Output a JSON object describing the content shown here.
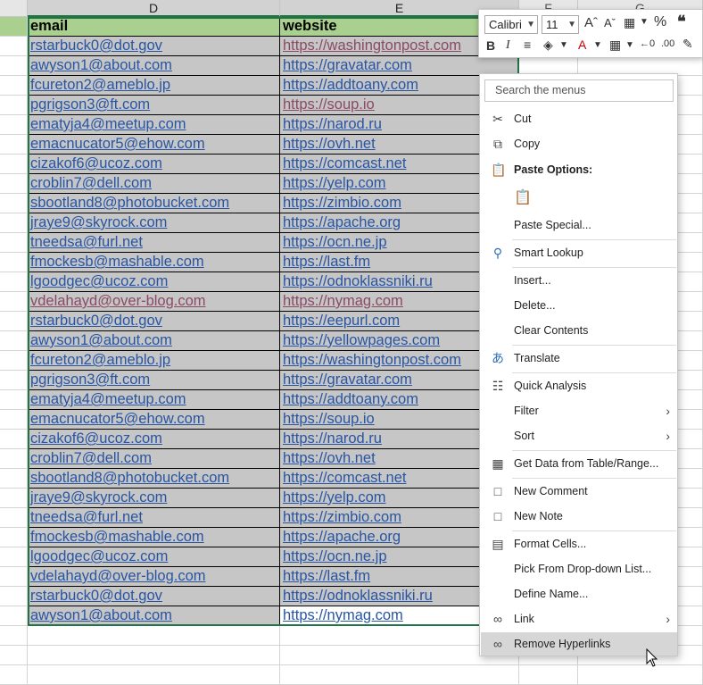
{
  "columns": {
    "d": "D",
    "e": "E",
    "f": "F",
    "g": "G"
  },
  "header": {
    "email": "email",
    "website": "website"
  },
  "rows": [
    {
      "email": "rstarbuck0@dot.gov",
      "website": "https://washingtonpost.com"
    },
    {
      "email": "awyson1@about.com",
      "website": "https://gravatar.com"
    },
    {
      "email": "fcureton2@ameblo.jp",
      "website": "https://addtoany.com"
    },
    {
      "email": "pgrigson3@ft.com",
      "website": "https://soup.io"
    },
    {
      "email": "ematyja4@meetup.com",
      "website": "https://narod.ru"
    },
    {
      "email": "emacnucator5@ehow.com",
      "website": "https://ovh.net"
    },
    {
      "email": "cizakof6@ucoz.com",
      "website": "https://comcast.net"
    },
    {
      "email": "croblin7@dell.com",
      "website": "https://yelp.com"
    },
    {
      "email": "sbootland8@photobucket.com",
      "website": "https://zimbio.com"
    },
    {
      "email": "jraye9@skyrock.com",
      "website": "https://apache.org"
    },
    {
      "email": "tneedsa@furl.net",
      "website": "https://ocn.ne.jp"
    },
    {
      "email": "fmockesb@mashable.com",
      "website": "https://last.fm"
    },
    {
      "email": "lgoodgec@ucoz.com",
      "website": "https://odnoklassniki.ru"
    },
    {
      "email": "vdelahayd@over-blog.com",
      "website": "https://nymag.com"
    },
    {
      "email": "rstarbuck0@dot.gov",
      "website": "https://eepurl.com"
    },
    {
      "email": "awyson1@about.com",
      "website": "https://yellowpages.com"
    },
    {
      "email": "fcureton2@ameblo.jp",
      "website": "https://washingtonpost.com"
    },
    {
      "email": "pgrigson3@ft.com",
      "website": "https://gravatar.com"
    },
    {
      "email": "ematyja4@meetup.com",
      "website": "https://addtoany.com"
    },
    {
      "email": "emacnucator5@ehow.com",
      "website": "https://soup.io"
    },
    {
      "email": "cizakof6@ucoz.com",
      "website": "https://narod.ru"
    },
    {
      "email": "croblin7@dell.com",
      "website": "https://ovh.net"
    },
    {
      "email": "sbootland8@photobucket.com",
      "website": "https://comcast.net"
    },
    {
      "email": "jraye9@skyrock.com",
      "website": "https://yelp.com"
    },
    {
      "email": "tneedsa@furl.net",
      "website": "https://zimbio.com"
    },
    {
      "email": "fmockesb@mashable.com",
      "website": "https://apache.org"
    },
    {
      "email": "lgoodgec@ucoz.com",
      "website": "https://ocn.ne.jp"
    },
    {
      "email": "vdelahayd@over-blog.com",
      "website": "https://last.fm"
    },
    {
      "email": "rstarbuck0@dot.gov",
      "website": "https://odnoklassniki.ru"
    },
    {
      "email": "awyson1@about.com",
      "website": "https://nymag.com"
    }
  ],
  "mini_toolbar": {
    "font": "Calibri",
    "size": "11"
  },
  "menu": {
    "search_placeholder": "Search the menus",
    "cut": "Cut",
    "copy": "Copy",
    "paste_options": "Paste Options:",
    "paste_special": "Paste Special...",
    "smart_lookup": "Smart Lookup",
    "insert": "Insert...",
    "delete": "Delete...",
    "clear_contents": "Clear Contents",
    "translate": "Translate",
    "quick_analysis": "Quick Analysis",
    "filter": "Filter",
    "sort": "Sort",
    "get_data": "Get Data from Table/Range...",
    "new_comment": "New Comment",
    "new_note": "New Note",
    "format_cells": "Format Cells...",
    "pick_list": "Pick From Drop-down List...",
    "define_name": "Define Name...",
    "link": "Link",
    "remove_hyperlinks": "Remove Hyperlinks"
  },
  "colors": {
    "header_fill": "#a9d08e",
    "selection_fill": "#c6c6c6",
    "link": "#2855a3",
    "visited_link": "#8a4a64",
    "selection_border": "#217346"
  }
}
